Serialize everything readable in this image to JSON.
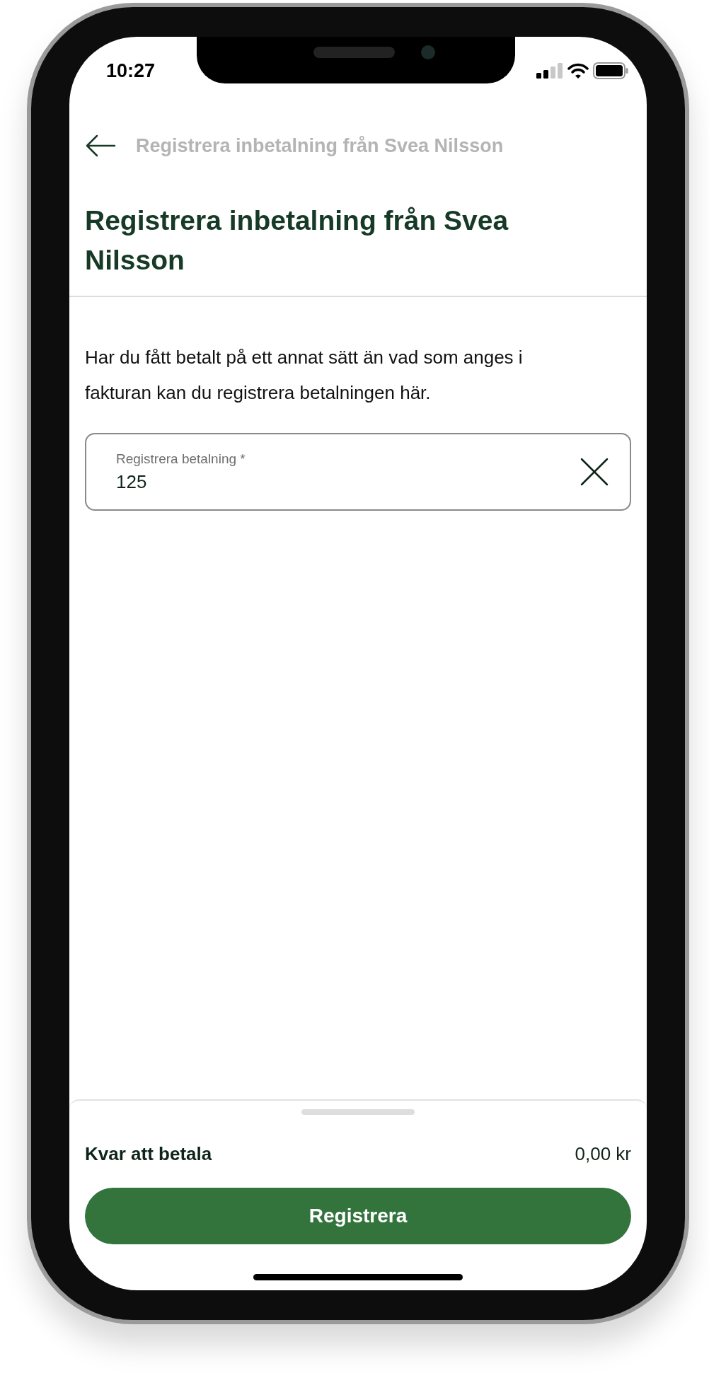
{
  "status_bar": {
    "time": "10:27"
  },
  "nav": {
    "title": "Registrera inbetalning från Svea Nilsson"
  },
  "header": {
    "title": "Registrera inbetalning från Svea Nilsson"
  },
  "description": "Har du fått betalt på ett annat sätt än vad som anges i fakturan kan du registrera betalningen här.",
  "field": {
    "label": "Registrera betalning *",
    "value": "125"
  },
  "summary": {
    "label": "Kvar att betala",
    "value": "0,00 kr"
  },
  "buttons": [
    "Registrera"
  ]
}
